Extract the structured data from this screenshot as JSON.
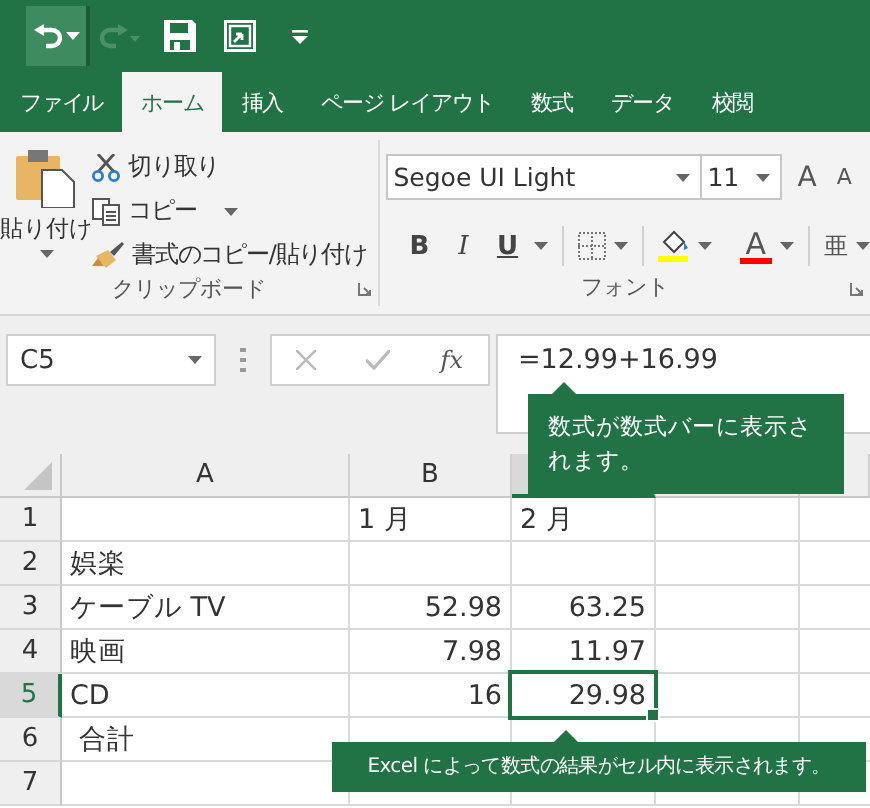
{
  "tabs": [
    {
      "label": "ファイル",
      "selected": false
    },
    {
      "label": "ホーム",
      "selected": true
    },
    {
      "label": "挿入",
      "selected": false
    },
    {
      "label": "ページ レイアウト",
      "selected": false
    },
    {
      "label": "数式",
      "selected": false
    },
    {
      "label": "データ",
      "selected": false
    },
    {
      "label": "校閲",
      "selected": false
    }
  ],
  "clipboard": {
    "paste": "貼り付け",
    "cut": "切り取り",
    "copy": "コピー",
    "format_painter": "書式のコピー/貼り付け",
    "label": "クリップボード"
  },
  "font": {
    "name": "Segoe UI Light",
    "size": "11",
    "grow": "A",
    "shrink": "A",
    "bold": "B",
    "italic": "I",
    "underline": "U",
    "font_color": "A",
    "phonetic": "亜",
    "label": "フォント"
  },
  "formula_bar": {
    "name_box": "C5",
    "fx": "fx",
    "formula": "=12.99+16.99"
  },
  "columns": [
    {
      "label": "A",
      "selected": false
    },
    {
      "label": "B",
      "selected": false
    },
    {
      "selected": true
    },
    {
      "selected": false
    },
    {
      "selected": false
    }
  ],
  "rows": [
    {
      "number": "1",
      "selected": false,
      "numeric": false,
      "cells": [
        "",
        "1 月",
        "2 月"
      ]
    },
    {
      "number": "2",
      "selected": false,
      "cells": [
        "娯楽"
      ]
    },
    {
      "number": "3",
      "selected": false,
      "numeric": true,
      "cells": [
        "ケーブル TV",
        "52.98",
        "63.25"
      ]
    },
    {
      "number": "4",
      "selected": false,
      "numeric": true,
      "cells": [
        "映画",
        "7.98",
        "11.97"
      ]
    },
    {
      "number": "5",
      "selected": true,
      "numeric": true,
      "cells": [
        "CD",
        "16",
        "29.98"
      ]
    },
    {
      "number": "6",
      "selected": false,
      "numeric": false,
      "cells": [
        " 合計"
      ]
    },
    {
      "number": "7",
      "selected": false
    }
  ],
  "callouts": [
    "数式が数式バーに表示されます。",
    "Excel によって数式の結果がセル内に表示されます。"
  ]
}
